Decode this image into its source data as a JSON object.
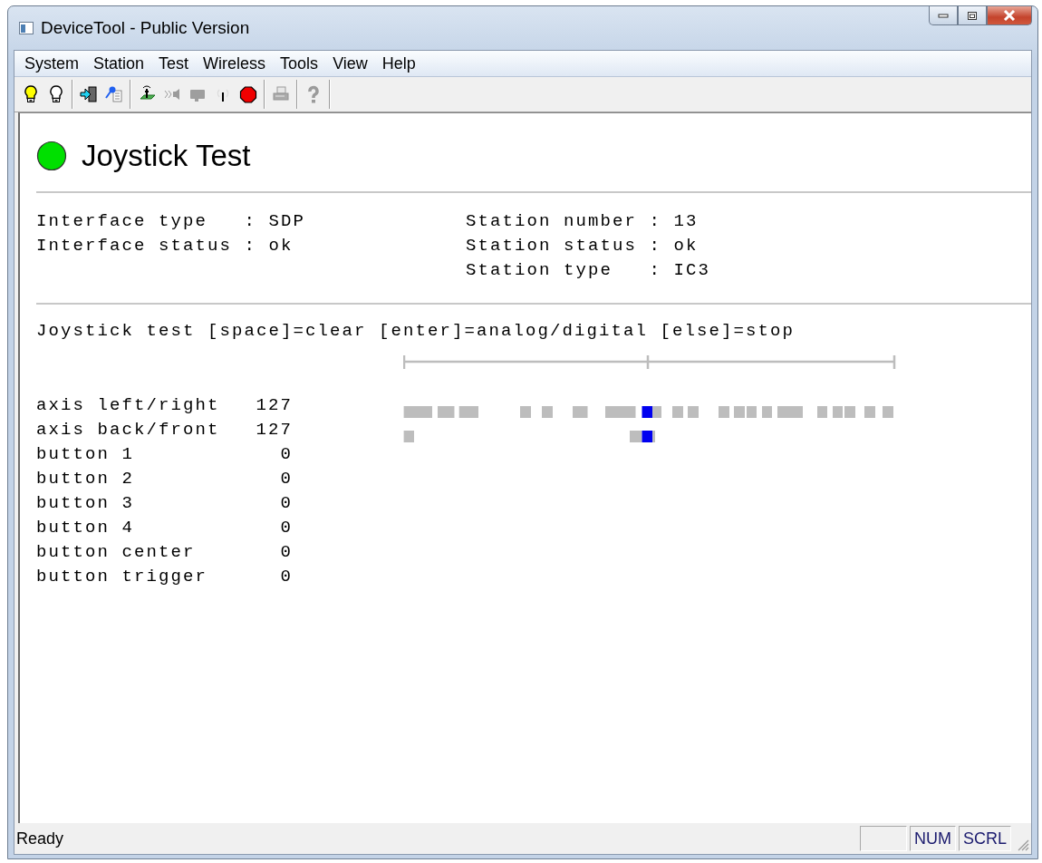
{
  "window": {
    "title": "DeviceTool - Public Version"
  },
  "menu": [
    "System",
    "Station",
    "Test",
    "Wireless",
    "Tools",
    "View",
    "Help"
  ],
  "toolbar": [
    {
      "kind": "bulbon",
      "disabled": false
    },
    {
      "kind": "bulboff",
      "disabled": false
    },
    {
      "kind": "separator"
    },
    {
      "kind": "enter",
      "disabled": false
    },
    {
      "kind": "keydoc",
      "disabled": false
    },
    {
      "kind": "separator"
    },
    {
      "kind": "antenna",
      "disabled": false
    },
    {
      "kind": "speaker",
      "disabled": true
    },
    {
      "kind": "card",
      "disabled": true
    },
    {
      "kind": "signal",
      "disabled": false
    },
    {
      "kind": "stop",
      "disabled": false
    },
    {
      "kind": "separator"
    },
    {
      "kind": "printer",
      "disabled": true
    },
    {
      "kind": "separator"
    },
    {
      "kind": "help",
      "disabled": true
    },
    {
      "kind": "separator"
    }
  ],
  "heading": "Joystick Test",
  "info_left": [
    "Interface type   : SDP",
    "Interface status : ok"
  ],
  "info_right": [
    "Station number : 13",
    "Station status : ok",
    "Station type   : IC3"
  ],
  "instructions": "Joystick test [space]=clear [enter]=analog/digital [else]=stop",
  "readings": [
    {
      "label": "axis left/right",
      "value": "127"
    },
    {
      "label": "axis back/front",
      "value": "127"
    },
    {
      "label": "button 1",
      "value": "0"
    },
    {
      "label": "button 2",
      "value": "0"
    },
    {
      "label": "button 3",
      "value": "0"
    },
    {
      "label": "button 4",
      "value": "0"
    },
    {
      "label": "button center",
      "value": "0"
    },
    {
      "label": "button trigger",
      "value": "0"
    }
  ],
  "status_bar": {
    "message": "Ready",
    "panes": [
      "NUM",
      "SCRL"
    ]
  }
}
